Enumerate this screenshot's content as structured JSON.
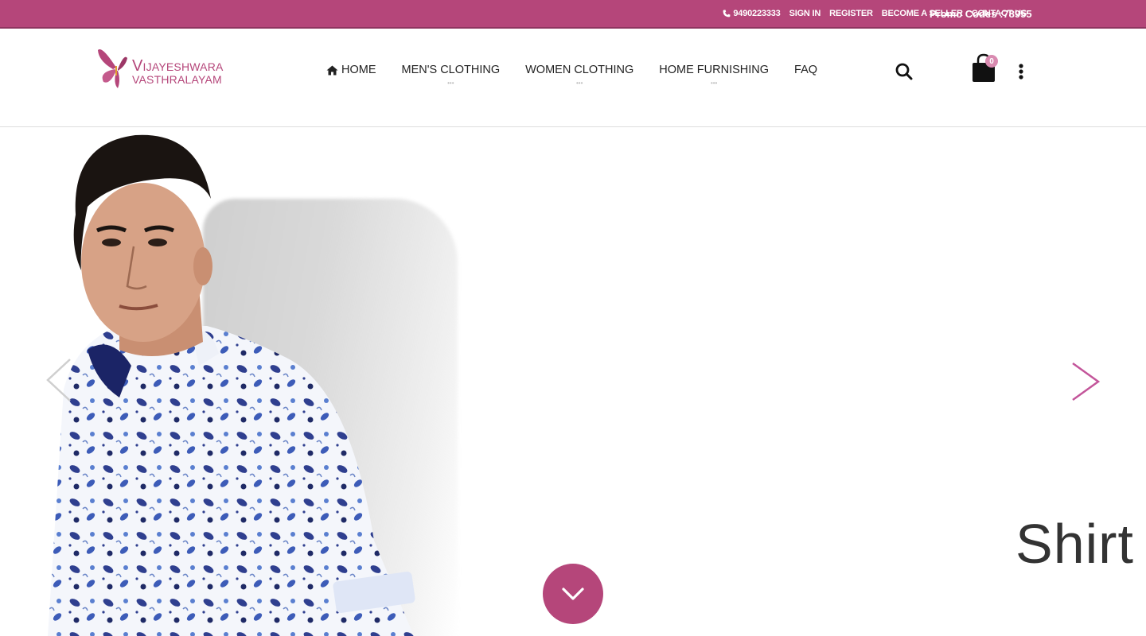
{
  "topbar": {
    "phone": "9490223333",
    "links": [
      "SIGN IN",
      "REGISTER",
      "BECOME A SELLER",
      "CONTACT US"
    ],
    "promo": "Promo Codes :78955"
  },
  "brand": {
    "line1": "IJAYESHWARA",
    "line2": "VASTHRALAYAM",
    "initial": "V"
  },
  "nav": {
    "items": [
      {
        "label": "HOME",
        "icon": "home-icon"
      },
      {
        "label": "MEN'S CLOTHING",
        "has_submenu": true
      },
      {
        "label": "WOMEN CLOTHING",
        "has_submenu": true
      },
      {
        "label": "HOME FURNISHING",
        "has_submenu": true
      },
      {
        "label": "FAQ"
      }
    ]
  },
  "header_actions": {
    "cart_count": "0"
  },
  "hero": {
    "slide_text": "Shirt"
  },
  "colors": {
    "brand": "#b5467a",
    "badge": "#d98ab0"
  }
}
